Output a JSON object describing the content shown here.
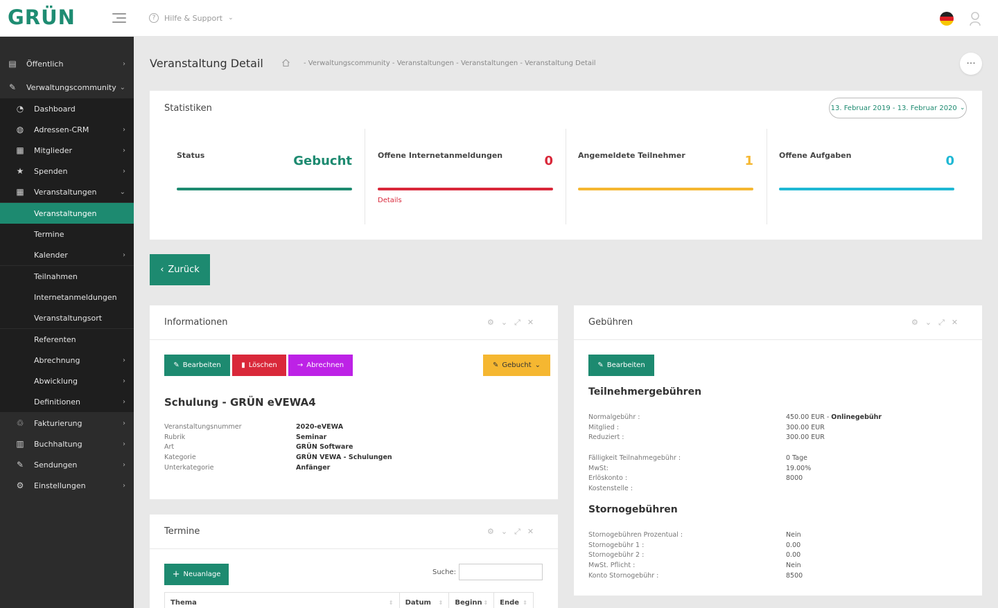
{
  "brand": {
    "logo": "GRÜN",
    "accent": "#1d8a70"
  },
  "topbar": {
    "help_label": "Hilfe & Support"
  },
  "sidebar": {
    "items": [
      {
        "label": "Öffentlich",
        "icon": "newspaper-icon",
        "chevron": "›"
      },
      {
        "label": "Verwaltungscommunity",
        "icon": "pencil-icon",
        "chevron": "⌄"
      },
      {
        "label": "Dashboard",
        "icon": "dashboard-icon",
        "chevron": ""
      },
      {
        "label": "Adressen-CRM",
        "icon": "globe-icon",
        "chevron": "›"
      },
      {
        "label": "Mitglieder",
        "icon": "id-card-icon",
        "chevron": "›"
      },
      {
        "label": "Spenden",
        "icon": "star-icon",
        "chevron": "›"
      },
      {
        "label": "Veranstaltungen",
        "icon": "grid-icon",
        "chevron": "⌄"
      },
      {
        "label": "Veranstaltungen",
        "icon": "",
        "chevron": ""
      },
      {
        "label": "Termine",
        "icon": "",
        "chevron": ""
      },
      {
        "label": "Kalender",
        "icon": "",
        "chevron": "›"
      },
      {
        "label": "Teilnahmen",
        "icon": "",
        "chevron": ""
      },
      {
        "label": "Internetanmeldungen",
        "icon": "",
        "chevron": ""
      },
      {
        "label": "Veranstaltungsort",
        "icon": "",
        "chevron": ""
      },
      {
        "label": "Referenten",
        "icon": "",
        "chevron": ""
      },
      {
        "label": "Abrechnung",
        "icon": "",
        "chevron": "›"
      },
      {
        "label": "Abwicklung",
        "icon": "",
        "chevron": "›"
      },
      {
        "label": "Definitionen",
        "icon": "",
        "chevron": "›"
      },
      {
        "label": "Fakturierung",
        "icon": "handshake-icon",
        "chevron": "›"
      },
      {
        "label": "Buchhaltung",
        "icon": "ledger-icon",
        "chevron": "›"
      },
      {
        "label": "Sendungen",
        "icon": "pencil-icon",
        "chevron": "›"
      },
      {
        "label": "Einstellungen",
        "icon": "settings-icon",
        "chevron": "›"
      }
    ]
  },
  "header": {
    "title": "Veranstaltung Detail",
    "breadcrumb": "-  Verwaltungscommunity  -  Veranstaltungen  -  Veranstaltungen  -  Veranstaltung Detail",
    "more": "···"
  },
  "stats": {
    "title": "Statistiken",
    "date_range": "13. Februar 2019 - 13. Februar 2020",
    "items": [
      {
        "label": "Status",
        "value": "Gebucht",
        "color": "#1d8a70",
        "link": ""
      },
      {
        "label": "Offene Internetanmeldungen",
        "value": "0",
        "color": "#d9283a",
        "link": "Details"
      },
      {
        "label": "Angemeldete Teilnehmer",
        "value": "1",
        "color": "#f5b731",
        "link": ""
      },
      {
        "label": "Offene Aufgaben",
        "value": "0",
        "color": "#1fb8d4",
        "link": ""
      }
    ]
  },
  "back_button": "Zurück",
  "info": {
    "title": "Informationen",
    "buttons": {
      "edit": "Bearbeiten",
      "delete": "Löschen",
      "bill": "Abrechnen",
      "status": "Gebucht"
    },
    "heading": "Schulung - GRÜN eVEWA4",
    "keys": [
      "Veranstaltungsnummer",
      "Rubrik",
      "Art",
      "Kategorie",
      "Unterkategorie"
    ],
    "values": [
      "2020-eVEWA",
      "Seminar",
      "GRÜN Software",
      "GRÜN VEWA - Schulungen",
      "Anfänger"
    ]
  },
  "termine": {
    "title": "Termine",
    "new_button": "Neuanlage",
    "search_label": "Suche:",
    "columns": [
      "Thema",
      "Datum",
      "Beginn",
      "Ende"
    ]
  },
  "fees": {
    "title": "Gebühren",
    "edit": "Bearbeiten",
    "participant_heading": "Teilnehmergebühren",
    "group1_keys": [
      "Normalgebühr :",
      "Mitglied :",
      "Reduziert :"
    ],
    "group1_vals": [
      "450.00 EUR - ",
      "300.00 EUR",
      "300.00 EUR"
    ],
    "online_label": "Onlinegebühr",
    "group2_keys": [
      "Fälligkeit Teilnahmegebühr :",
      "MwSt:",
      "Erlöskonto :",
      "Kostenstelle :"
    ],
    "group2_vals": [
      "0 Tage",
      "19.00%",
      "8000",
      ""
    ],
    "cancel_heading": "Stornogebühren",
    "group3_keys": [
      "Stornogebühren Prozentual :",
      "Stornogebühr 1 :",
      "Stornogebühr 2 :",
      "MwSt. Pflicht :",
      "Konto Stornogebühr :"
    ],
    "group3_vals": [
      "Nein",
      "0.00",
      "0.00",
      "Nein",
      "8500"
    ]
  }
}
